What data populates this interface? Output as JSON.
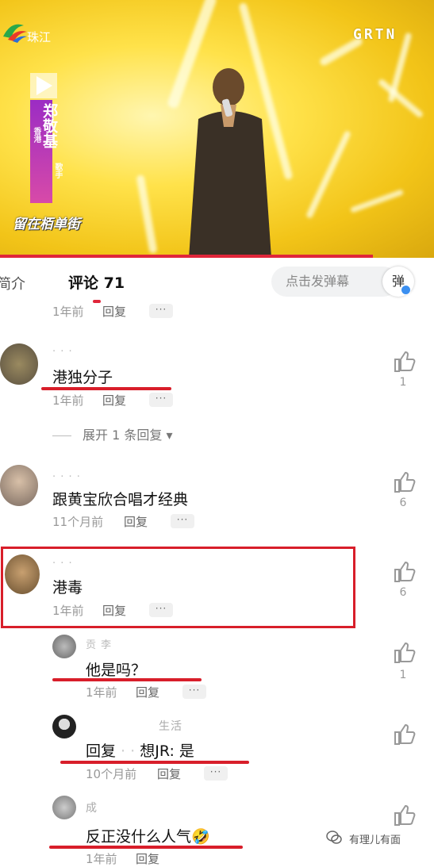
{
  "video": {
    "channel_logo_text": "珠江",
    "brand": "GRTN",
    "singer_name": "郑敬基",
    "singer_sub1": "香港",
    "singer_sub2": "歌手",
    "song_title": "留在栢单街",
    "colors": {
      "background": "#f2c418",
      "progress": "#e0263a"
    }
  },
  "tabs": {
    "intro": "简介",
    "comments": "评论 71",
    "danmaku_placeholder": "点击发弹幕",
    "danmaku_button": "弹"
  },
  "comments": [
    {
      "time": "1年前",
      "reply": "回复",
      "more": "···"
    },
    {
      "text": "港独分子",
      "time": "1年前",
      "reply": "回复",
      "more": "···",
      "likes": "1",
      "expand": "展开 1 条回复 ▾"
    },
    {
      "text": "跟黄宝欣合唱才经典",
      "time": "11个月前",
      "reply": "回复",
      "more": "···",
      "likes": "6"
    },
    {
      "text": "港毒",
      "time": "1年前",
      "reply": "回复",
      "more": "···",
      "likes": "6"
    },
    {
      "text": "他是吗？",
      "time": "1年前",
      "reply": "回复",
      "more": "···",
      "likes": "1",
      "username": "贡 李"
    },
    {
      "text": "回复 ",
      "text_part2": "想JR: 是",
      "time": "10个月前",
      "reply": "回复",
      "more": "···",
      "username": "生活"
    },
    {
      "text": "反正没什么人气",
      "emoji": "🤣",
      "time": "1年前",
      "reply": "回复",
      "username": "成"
    }
  ],
  "watermark": "有理儿有面",
  "icons": [
    "thumbs-up-icon",
    "play-icon",
    "wechat-icon"
  ]
}
